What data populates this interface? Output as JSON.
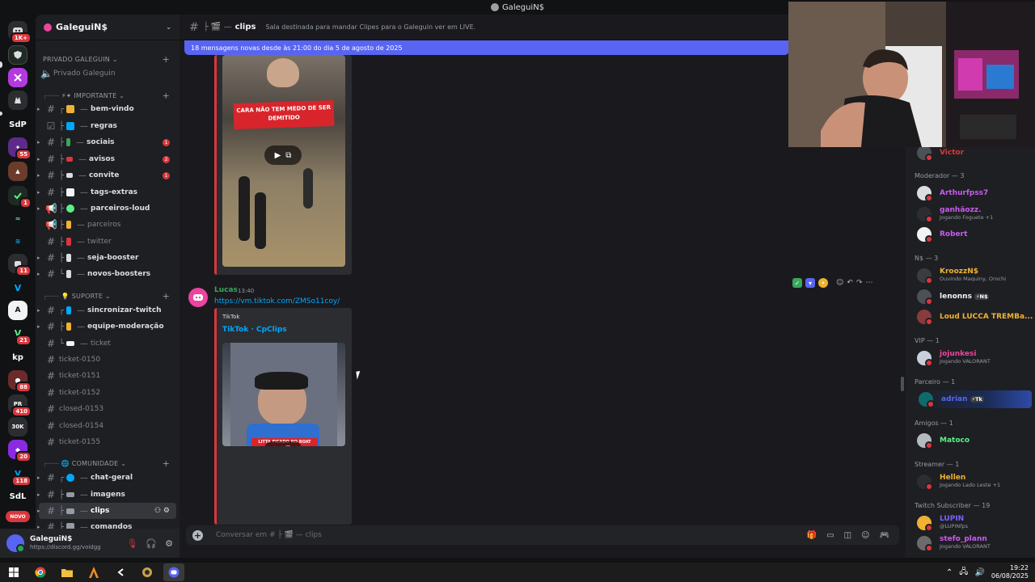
{
  "window_title": "GaleguiN$",
  "server_rail": {
    "badges": [
      "1K+",
      "55",
      "1",
      "11",
      "88",
      "410",
      "20",
      "118"
    ],
    "labels": [
      "SdP",
      "kp",
      "SdL"
    ],
    "novo_label": "NOVO"
  },
  "sidebar": {
    "guild_name": "GaleguiN$",
    "categories": {
      "privado": "PRIVADO GALEGUIN",
      "importante": "✦ IMPORTANTE",
      "suporte": "SUPORTE",
      "comunidade": "COMUNIDADE"
    },
    "voice_channel": "Privado Galeguin",
    "channels": [
      {
        "name": "bem-vindo"
      },
      {
        "name": "regras"
      },
      {
        "name": "sociais",
        "unread": "1"
      },
      {
        "name": "avisos",
        "unread": "2"
      },
      {
        "name": "convite",
        "unread": "1"
      },
      {
        "name": "tags-extras"
      },
      {
        "name": "parceiros-loud"
      },
      {
        "name": "parceiros"
      },
      {
        "name": "twitter"
      },
      {
        "name": "seja-booster"
      },
      {
        "name": "novos-boosters"
      },
      {
        "name": "sincronizar-twitch"
      },
      {
        "name": "equipe-moderação"
      },
      {
        "name": "ticket"
      },
      {
        "name": "ticket-0150"
      },
      {
        "name": "ticket-0151"
      },
      {
        "name": "ticket-0152"
      },
      {
        "name": "closed-0153"
      },
      {
        "name": "closed-0154"
      },
      {
        "name": "ticket-0155"
      },
      {
        "name": "chat-geral"
      },
      {
        "name": "imagens"
      },
      {
        "name": "clips"
      },
      {
        "name": "comandos"
      }
    ]
  },
  "user_panel": {
    "name": "GaleguiN$",
    "status": "https://discord.gg/voidgg"
  },
  "chat": {
    "channel_name": "clips",
    "topic": "Sala destinada para mandar Clipes para o Galeguin ver em LIVE.",
    "new_messages_bar": "18 mensagens novas desde às 21:00 do dia 5 de agosto de 2025",
    "video1_caption": "CARA NÃO TEM MEDO DE SER DEMITIDO",
    "message": {
      "author": "Lucas",
      "time": "13:40",
      "link": "https://vm.tiktok.com/ZMSo11coy/",
      "embed_provider": "TikTok",
      "embed_title": "TikTok · CpClips",
      "video_caption": "LITTA FICADO NO ROAT"
    },
    "composer_placeholder": "Conversar em # ├ 🎬 — clips"
  },
  "members": {
    "groups": [
      {
        "role": "Moderador — 3"
      },
      {
        "role": "N$ — 3"
      },
      {
        "role": "VIP — 1"
      },
      {
        "role": "Parceiro — 1"
      },
      {
        "role": "Amigos — 1"
      },
      {
        "role": "Streamer — 1"
      },
      {
        "role": "Twitch Subscriber — 19"
      }
    ],
    "list": [
      {
        "name": "Victor",
        "color": "#da373c"
      },
      {
        "name": "Arthurfpss7",
        "color": "#c85cf0"
      },
      {
        "name": "ganhãozz.",
        "color": "#c85cf0",
        "activity": "Jogando Foguete +1"
      },
      {
        "name": "Robert",
        "color": "#c85cf0"
      },
      {
        "name": "KroozzN$",
        "color": "#f0b232",
        "activity": "Ouvindo Maquiny, Orochi"
      },
      {
        "name": "lenonns",
        "color": "#f2f3f5",
        "tag": "⚡N$"
      },
      {
        "name": "Loud LUCCA TREMBa...",
        "color": "#f0b232"
      },
      {
        "name": "jojunkesi",
        "color": "#eb459e",
        "activity": "Jogando VALORANT"
      },
      {
        "name": "adrian",
        "color": "#5865f2",
        "tag": "⚡Tk"
      },
      {
        "name": "Matoco",
        "color": "#57f287"
      },
      {
        "name": "Hellen",
        "color": "#f0b232",
        "activity": "Jogando Lado Leste +1"
      },
      {
        "name": "LUPIN",
        "color": "#7b61ff",
        "activity": "@LUPINfps"
      },
      {
        "name": "stefo_plann",
        "color": "#c85cf0",
        "activity": "Jogando VALORANT"
      }
    ]
  },
  "taskbar": {
    "time": "19:22",
    "date": "06/08/2025"
  }
}
